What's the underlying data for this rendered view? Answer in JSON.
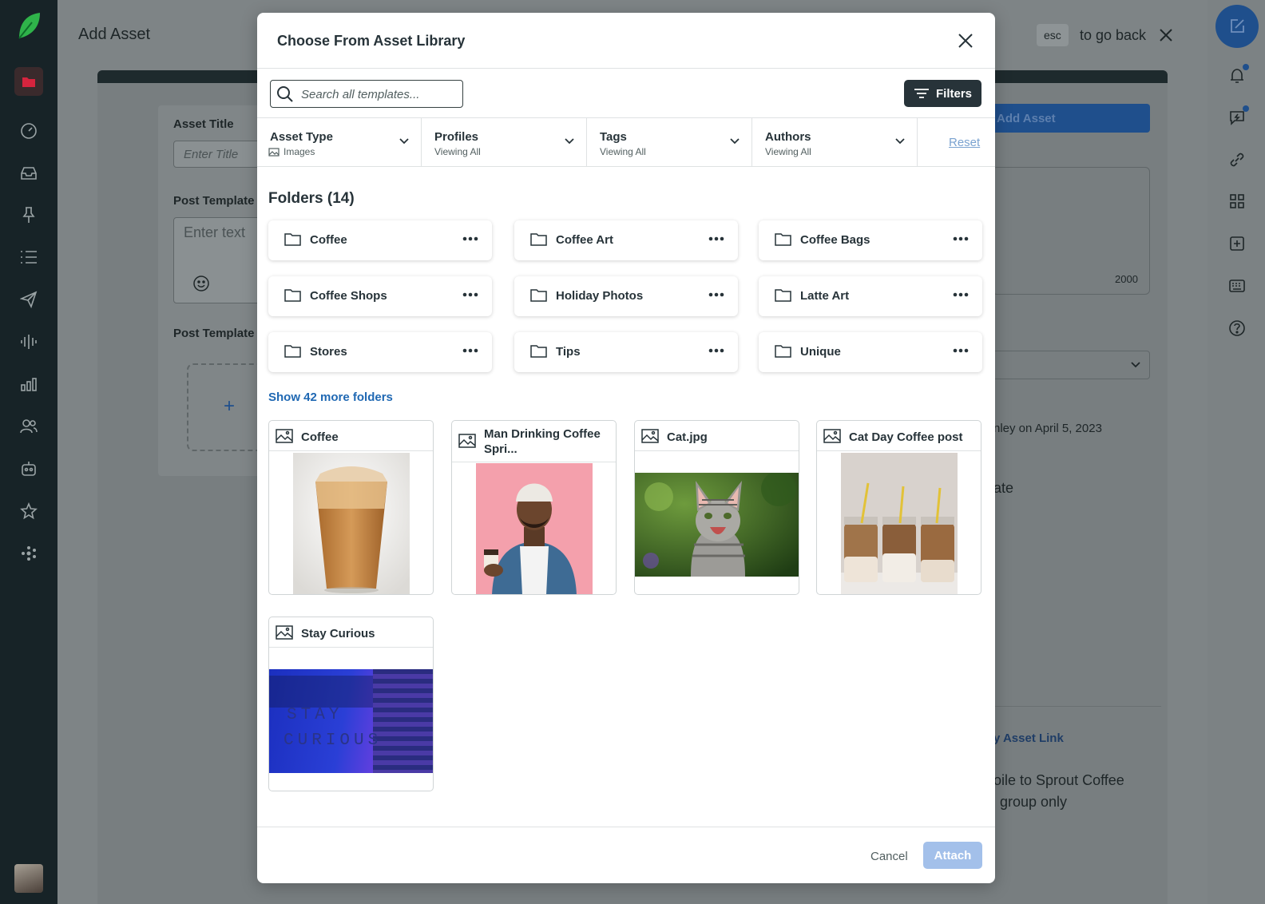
{
  "background": {
    "page_title": "Add Asset",
    "esc_key": "esc",
    "go_back": "to go back",
    "asset_title_label": "Asset Title",
    "title_placeholder": "Enter Title",
    "post_template_label": "Post Template",
    "post_template_label_2": "Post Template",
    "enter_text": "Enter text",
    "add_asset_btn": "Add Asset",
    "char_count": "2000",
    "meta_text": "nley on April 5, 2023",
    "ate_text": "ate",
    "asset_link": "y Asset Link",
    "visibility_1": "oile to Sprout Coffee",
    "visibility_2": "group only"
  },
  "modal": {
    "title": "Choose From Asset Library",
    "search_placeholder": "Search all templates...",
    "filters_label": "Filters",
    "filters": [
      {
        "label": "Asset Type",
        "sub": "Images"
      },
      {
        "label": "Profiles",
        "sub": "Viewing All"
      },
      {
        "label": "Tags",
        "sub": "Viewing All"
      },
      {
        "label": "Authors",
        "sub": "Viewing All"
      }
    ],
    "reset_label": "Reset",
    "folders_title": "Folders (14)",
    "folders": [
      {
        "name": "Coffee"
      },
      {
        "name": "Coffee Art"
      },
      {
        "name": "Coffee Bags"
      },
      {
        "name": "Coffee Shops"
      },
      {
        "name": "Holiday Photos"
      },
      {
        "name": "Latte Art"
      },
      {
        "name": "Stores"
      },
      {
        "name": "Tips"
      },
      {
        "name": "Unique"
      }
    ],
    "show_more": "Show 42 more folders",
    "assets": [
      {
        "name": "Coffee"
      },
      {
        "name": "Man Drinking Coffee Spri..."
      },
      {
        "name": "Cat.jpg"
      },
      {
        "name": "Cat Day Coffee post"
      },
      {
        "name": "Stay Curious"
      }
    ],
    "stay_curious_line1": "STAY",
    "stay_curious_line2": "CURIOUS",
    "cancel_label": "Cancel",
    "attach_label": "Attach"
  },
  "colors": {
    "primary": "#273339",
    "link": "#1f68b3",
    "attach_disabled": "#a3c0ea",
    "brand_blue": "#1f4f8c"
  }
}
